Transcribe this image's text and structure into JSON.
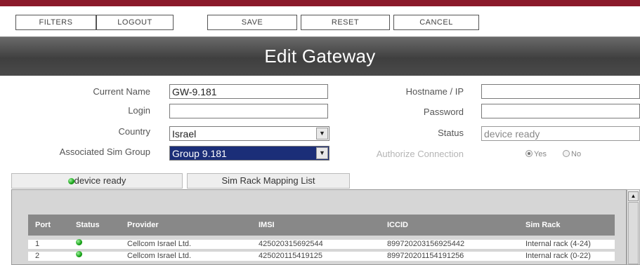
{
  "colors": {
    "accent": "#8b1a2b",
    "title_bar": "#4a4a4a",
    "header_row": "#888888",
    "status_ok": "#13a013"
  },
  "toolbar": {
    "filters": "FILTERS",
    "logout": "LOGOUT",
    "save": "SAVE",
    "reset": "RESET",
    "cancel": "CANCEL"
  },
  "page_title": "Edit Gateway",
  "form": {
    "current_name_label": "Current Name",
    "current_name_value": "GW-9.181",
    "login_label": "Login",
    "login_value": "",
    "country_label": "Country",
    "country_value": "Israel",
    "sim_group_label": "Associated Sim Group",
    "sim_group_value": "Group 9.181",
    "hostname_label": "Hostname / IP",
    "hostname_value": "",
    "password_label": "Password",
    "password_value": "",
    "status_label": "Status",
    "status_value": "device ready",
    "authorize_label": "Authorize Connection",
    "authorize_yes": "Yes",
    "authorize_no": "No",
    "authorize_selected": "Yes"
  },
  "tabs": [
    {
      "label": "device ready",
      "icon": "green-status-dot"
    },
    {
      "label": "Sim Rack Mapping List"
    }
  ],
  "table": {
    "headers": [
      "Port",
      "Status",
      "Provider",
      "IMSI",
      "ICCID",
      "Sim Rack"
    ],
    "rows": [
      {
        "port": "1",
        "status": "ok",
        "provider": "Cellcom Israel Ltd.",
        "imsi": "425020315692544",
        "iccid": "899720203156925442",
        "sim_rack": "Internal rack (4-24)"
      },
      {
        "port": "2",
        "status": "ok",
        "provider": "Cellcom Israel Ltd.",
        "imsi": "425020115419125",
        "iccid": "899720201154191256",
        "sim_rack": "Internal rack (0-22)"
      }
    ]
  }
}
